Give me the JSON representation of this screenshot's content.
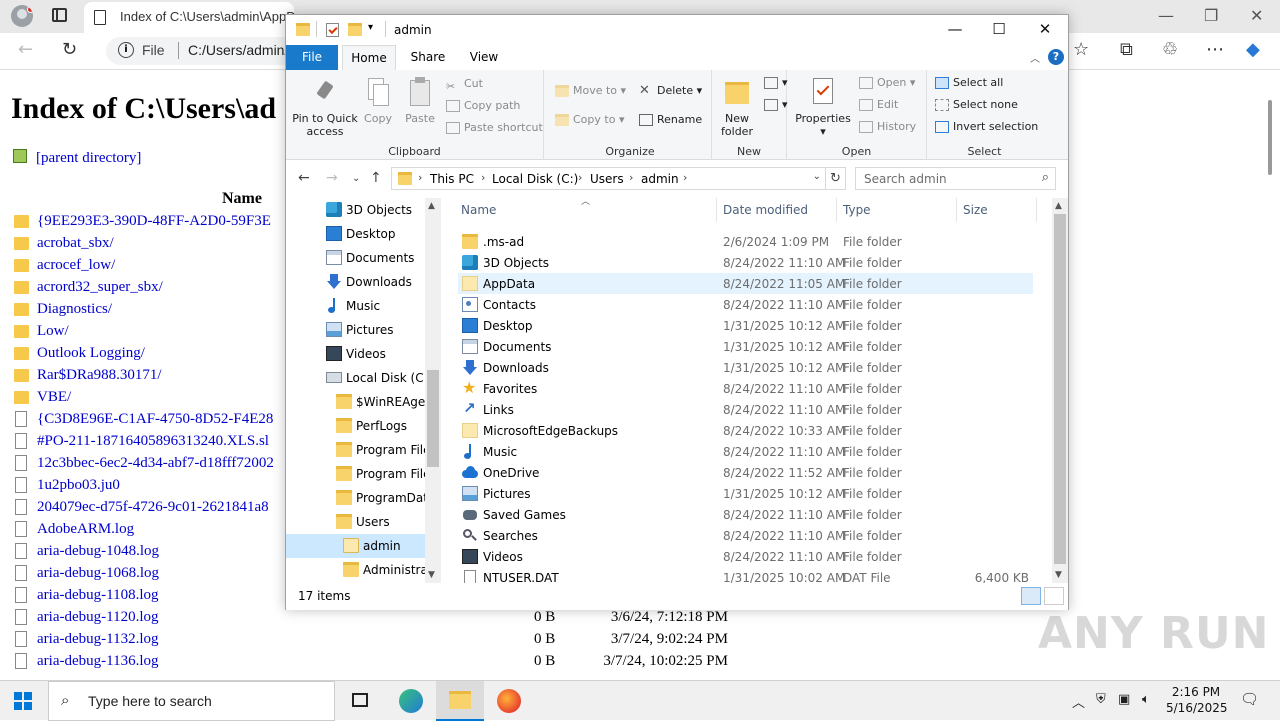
{
  "browser": {
    "tab_title": "Index of C:\\Users\\admin\\AppD",
    "address_label": "File",
    "address_url": "C:/Users/admin/",
    "page": {
      "heading": "Index of C:\\Users\\ad",
      "parent_link": "[parent directory]",
      "col_name": "Name",
      "rows": [
        {
          "name": "{9EE293E3-390D-48FF-A2D0-59F3E",
          "type": "folder"
        },
        {
          "name": "acrobat_sbx/",
          "type": "folder"
        },
        {
          "name": "acrocef_low/",
          "type": "folder"
        },
        {
          "name": "acrord32_super_sbx/",
          "type": "folder"
        },
        {
          "name": "Diagnostics/",
          "type": "folder"
        },
        {
          "name": "Low/",
          "type": "folder"
        },
        {
          "name": "Outlook Logging/",
          "type": "folder"
        },
        {
          "name": "Rar$DRa988.30171/",
          "type": "folder"
        },
        {
          "name": "VBE/",
          "type": "folder"
        },
        {
          "name": "{C3D8E96E-C1AF-4750-8D52-F4E28",
          "type": "file"
        },
        {
          "name": "#PO-211-18716405896313240.XLS.sl",
          "type": "file"
        },
        {
          "name": "12c3bbec-6ec2-4d34-abf7-d18fff72002",
          "type": "file"
        },
        {
          "name": "1u2pbo03.ju0",
          "type": "file"
        },
        {
          "name": "204079ec-d75f-4726-9c01-2621841a8",
          "type": "file"
        },
        {
          "name": "AdobeARM.log",
          "type": "file"
        },
        {
          "name": "aria-debug-1048.log",
          "type": "file"
        },
        {
          "name": "aria-debug-1068.log",
          "type": "file"
        },
        {
          "name": "aria-debug-1108.log",
          "type": "file"
        },
        {
          "name": "aria-debug-1120.log",
          "type": "file",
          "size": "0 B",
          "date": "3/6/24, 7:12:18 PM"
        },
        {
          "name": "aria-debug-1132.log",
          "type": "file",
          "size": "0 B",
          "date": "3/7/24, 9:02:24 PM"
        },
        {
          "name": "aria-debug-1136.log",
          "type": "file",
          "size": "0 B",
          "date": "3/7/24, 10:02:25 PM"
        }
      ]
    },
    "watermark": "ANY RUN"
  },
  "explorer": {
    "title": "admin",
    "tabs": [
      "File",
      "Home",
      "Share",
      "View"
    ],
    "ribbon": {
      "clipboard": {
        "label": "Clipboard",
        "pin": "Pin to Quick access",
        "copy": "Copy",
        "paste": "Paste",
        "cut": "Cut",
        "copy_path": "Copy path",
        "paste_shortcut": "Paste shortcut"
      },
      "organize": {
        "label": "Organize",
        "move_to": "Move to",
        "copy_to": "Copy to",
        "delete": "Delete",
        "rename": "Rename"
      },
      "new": {
        "label": "New",
        "new_folder": "New folder"
      },
      "open": {
        "label": "Open",
        "properties": "Properties",
        "open": "Open",
        "edit": "Edit",
        "history": "History"
      },
      "select": {
        "label": "Select",
        "select_all": "Select all",
        "select_none": "Select none",
        "invert": "Invert selection"
      }
    },
    "address": {
      "crumbs": [
        "This PC",
        "Local Disk (C:)",
        "Users",
        "admin"
      ]
    },
    "search_placeholder": "Search admin",
    "nav": [
      {
        "label": "3D Objects",
        "icon": "cube-icon",
        "indent": 1
      },
      {
        "label": "Desktop",
        "icon": "desktop-icon",
        "indent": 1
      },
      {
        "label": "Documents",
        "icon": "documents-icon",
        "indent": 1
      },
      {
        "label": "Downloads",
        "icon": "download-icon",
        "indent": 1
      },
      {
        "label": "Music",
        "icon": "music-icon",
        "indent": 1
      },
      {
        "label": "Pictures",
        "icon": "pictures-icon",
        "indent": 1
      },
      {
        "label": "Videos",
        "icon": "videos-icon",
        "indent": 1
      },
      {
        "label": "Local Disk (C:)",
        "icon": "drive-icon",
        "indent": 1
      },
      {
        "label": "$WinREAgent",
        "icon": "folder-icon",
        "indent": 2
      },
      {
        "label": "PerfLogs",
        "icon": "folder-icon",
        "indent": 2
      },
      {
        "label": "Program Files",
        "icon": "folder-icon",
        "indent": 2
      },
      {
        "label": "Program Files",
        "icon": "folder-icon",
        "indent": 2
      },
      {
        "label": "ProgramData",
        "icon": "folder-icon",
        "indent": 2
      },
      {
        "label": "Users",
        "icon": "folder-icon",
        "indent": 2
      },
      {
        "label": "admin",
        "icon": "folder-icon",
        "indent": 3,
        "selected": true
      },
      {
        "label": "Administrat",
        "icon": "folder-icon",
        "indent": 3
      }
    ],
    "columns": {
      "name": "Name",
      "date": "Date modified",
      "type": "Type",
      "size": "Size"
    },
    "files": [
      {
        "name": ".ms-ad",
        "date": "2/6/2024 1:09 PM",
        "type": "File folder",
        "size": "",
        "icon": "folder-icon"
      },
      {
        "name": "3D Objects",
        "date": "8/24/2022 11:10 AM",
        "type": "File folder",
        "size": "",
        "icon": "cube-icon"
      },
      {
        "name": "AppData",
        "date": "8/24/2022 11:05 AM",
        "type": "File folder",
        "size": "",
        "icon": "folder-icon",
        "selected": true
      },
      {
        "name": "Contacts",
        "date": "8/24/2022 11:10 AM",
        "type": "File folder",
        "size": "",
        "icon": "contacts-icon"
      },
      {
        "name": "Desktop",
        "date": "1/31/2025 10:12 AM",
        "type": "File folder",
        "size": "",
        "icon": "desktop-icon"
      },
      {
        "name": "Documents",
        "date": "1/31/2025 10:12 AM",
        "type": "File folder",
        "size": "",
        "icon": "documents-icon"
      },
      {
        "name": "Downloads",
        "date": "1/31/2025 10:12 AM",
        "type": "File folder",
        "size": "",
        "icon": "download-icon"
      },
      {
        "name": "Favorites",
        "date": "8/24/2022 11:10 AM",
        "type": "File folder",
        "size": "",
        "icon": "star-icon"
      },
      {
        "name": "Links",
        "date": "8/24/2022 11:10 AM",
        "type": "File folder",
        "size": "",
        "icon": "link-icon"
      },
      {
        "name": "MicrosoftEdgeBackups",
        "date": "8/24/2022 10:33 AM",
        "type": "File folder",
        "size": "",
        "icon": "folder-icon"
      },
      {
        "name": "Music",
        "date": "8/24/2022 11:10 AM",
        "type": "File folder",
        "size": "",
        "icon": "music-icon"
      },
      {
        "name": "OneDrive",
        "date": "8/24/2022 11:52 AM",
        "type": "File folder",
        "size": "",
        "icon": "cloud-icon"
      },
      {
        "name": "Pictures",
        "date": "1/31/2025 10:12 AM",
        "type": "File folder",
        "size": "",
        "icon": "pictures-icon"
      },
      {
        "name": "Saved Games",
        "date": "8/24/2022 11:10 AM",
        "type": "File folder",
        "size": "",
        "icon": "games-icon"
      },
      {
        "name": "Searches",
        "date": "8/24/2022 11:10 AM",
        "type": "File folder",
        "size": "",
        "icon": "search-icon"
      },
      {
        "name": "Videos",
        "date": "8/24/2022 11:10 AM",
        "type": "File folder",
        "size": "",
        "icon": "videos-icon"
      },
      {
        "name": "NTUSER.DAT",
        "date": "1/31/2025 10:02 AM",
        "type": "DAT File",
        "size": "6,400 KB",
        "icon": "file-icon"
      }
    ],
    "status": "17 items"
  },
  "taskbar": {
    "search_placeholder": "Type here to search",
    "time": "2:16 PM",
    "date": "5/16/2025"
  }
}
